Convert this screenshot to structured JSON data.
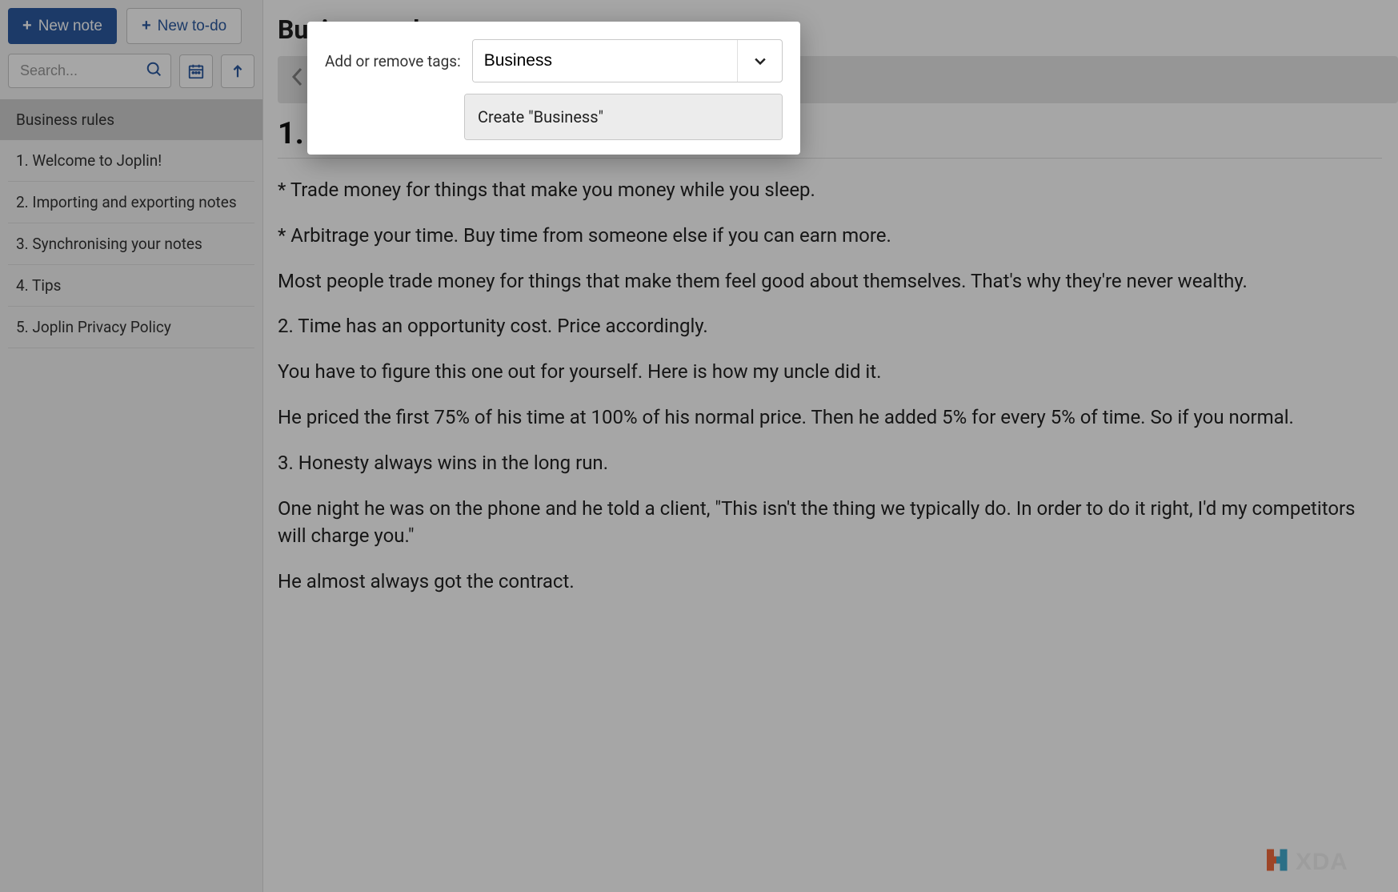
{
  "sidebar": {
    "new_note_label": "New note",
    "new_todo_label": "New to-do",
    "search_placeholder": "Search...",
    "selected_note": "Business rules",
    "notes": [
      "1. Welcome to Joplin!",
      "2. Importing and exporting notes",
      "3. Synchronising your notes",
      "4. Tips",
      "5. Joplin Privacy Policy"
    ]
  },
  "main": {
    "title": "Business rules",
    "heading_visible": "1.",
    "paragraphs": [
      "* Trade money for things that make you money while you sleep.",
      "* Arbitrage your time. Buy time from someone else if you can earn more.",
      "Most people trade money for things that make them feel good about themselves. That's why they're never wealthy.",
      "2. Time has an opportunity cost. Price accordingly.",
      "You have to figure this one out for yourself. Here is how my uncle did it.",
      "He priced the first 75% of his time at 100% of his normal price. Then he added 5% for every 5% of time. So if you normal.",
      "3. Honesty always wins in the long run.",
      "One night he was on the phone and he told a client, \"This isn't the thing we typically do. In order to do it right, I'd my competitors will charge you.\"",
      "He almost always got the contract."
    ]
  },
  "modal": {
    "label": "Add or remove tags:",
    "input_value": "Business",
    "option": "Create \"Business\""
  },
  "watermark": "XDA"
}
